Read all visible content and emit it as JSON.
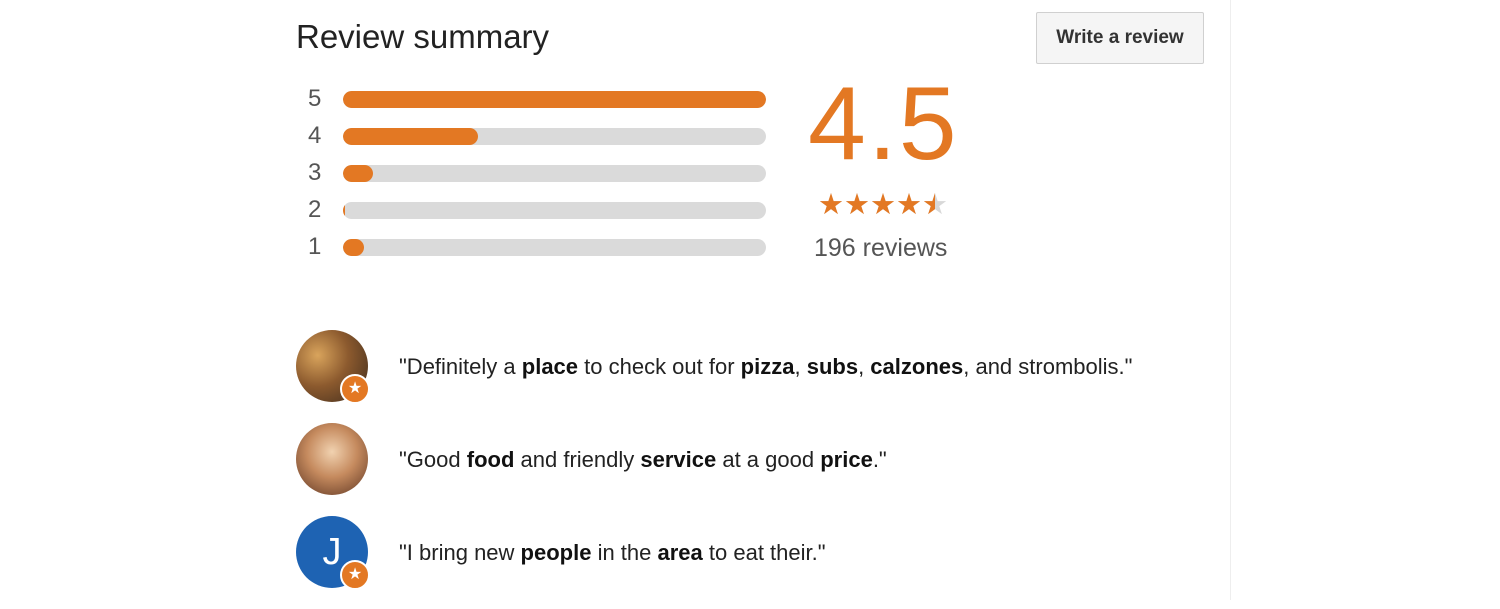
{
  "header": {
    "title": "Review summary",
    "write_review_label": "Write a review"
  },
  "summary": {
    "average_rating": "4.5",
    "rating_value": 4.5,
    "max_rating": 5,
    "review_count_text": "196 reviews"
  },
  "distribution": [
    {
      "stars": "5",
      "fraction": 1.0
    },
    {
      "stars": "4",
      "fraction": 0.32
    },
    {
      "stars": "3",
      "fraction": 0.07
    },
    {
      "stars": "2",
      "fraction": 0.005
    },
    {
      "stars": "1",
      "fraction": 0.05
    }
  ],
  "reviews": [
    {
      "avatar_initial": "",
      "segments": [
        {
          "text": "\"Definitely a ",
          "bold": false
        },
        {
          "text": "place",
          "bold": true
        },
        {
          "text": " to check out for ",
          "bold": false
        },
        {
          "text": "pizza",
          "bold": true
        },
        {
          "text": ", ",
          "bold": false
        },
        {
          "text": "subs",
          "bold": true
        },
        {
          "text": ", ",
          "bold": false
        },
        {
          "text": "calzones",
          "bold": true
        },
        {
          "text": ", and strombolis.\"",
          "bold": false
        }
      ]
    },
    {
      "avatar_initial": "",
      "segments": [
        {
          "text": "\"Good ",
          "bold": false
        },
        {
          "text": "food",
          "bold": true
        },
        {
          "text": " and friendly ",
          "bold": false
        },
        {
          "text": "service",
          "bold": true
        },
        {
          "text": " at a good ",
          "bold": false
        },
        {
          "text": "price",
          "bold": true
        },
        {
          "text": ".\"",
          "bold": false
        }
      ]
    },
    {
      "avatar_initial": "J",
      "segments": [
        {
          "text": "\"I bring new ",
          "bold": false
        },
        {
          "text": "people",
          "bold": true
        },
        {
          "text": " in the ",
          "bold": false
        },
        {
          "text": "area",
          "bold": true
        },
        {
          "text": " to eat their.\"",
          "bold": false
        }
      ]
    }
  ],
  "icons": {
    "star": "star-icon",
    "badge": "local-guide-star-badge-icon"
  },
  "colors": {
    "accent": "#e37823",
    "track": "#dadada",
    "avatar_blue": "#1e63b3"
  }
}
